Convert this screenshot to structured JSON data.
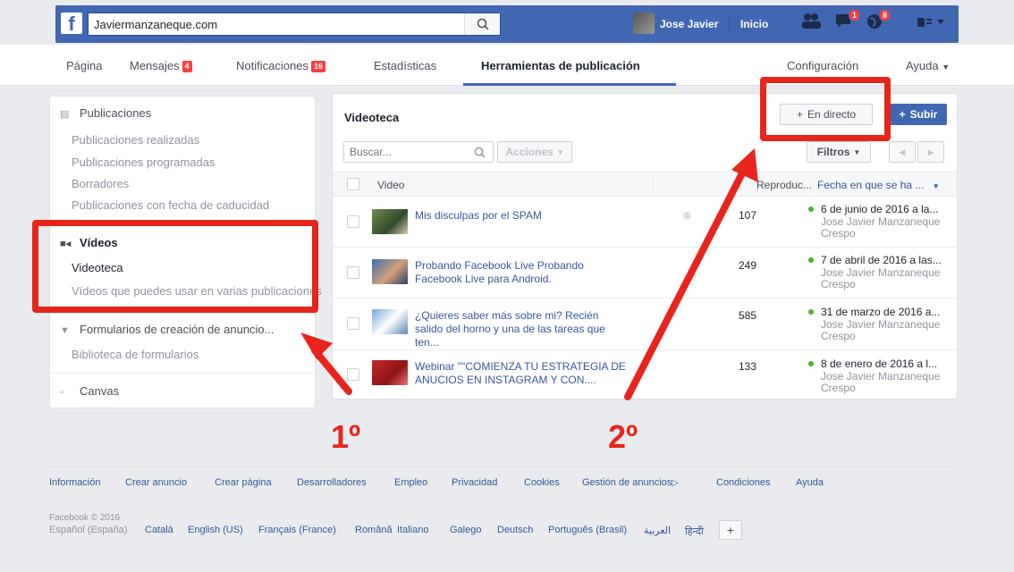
{
  "topbar": {
    "search_value": "Javiermanzaneque.com",
    "user_name": "Jose Javier",
    "home_label": "Inicio",
    "friend_requests_badge": "",
    "messages_badge": "1",
    "notifications_badge": "8",
    "icons": [
      "facebook-logo",
      "search-icon",
      "friends-icon",
      "messages-icon",
      "globe-icon",
      "account-menu-icon"
    ]
  },
  "tabs": {
    "pagina": "Página",
    "mensajes": "Mensajes",
    "mensajes_badge": "4",
    "notificaciones": "Notificaciones",
    "notificaciones_badge": "16",
    "estadisticas": "Estadísticas",
    "herramientas": "Herramientas de publicación",
    "configuracion": "Configuración",
    "ayuda": "Ayuda"
  },
  "sidebar": {
    "publicaciones_header": "Publicaciones",
    "publicaciones_realizadas": "Publicaciones realizadas",
    "publicaciones_programadas": "Publicaciones programadas",
    "borradores": "Borradores",
    "publicaciones_caducidad": "Publicaciones con fecha de caducidad",
    "videos_header": "Vídeos",
    "videoteca": "Videoteca",
    "videos_varias": "Vídeos que puedes usar en varias publicaciones",
    "formularios_header": "Formularios de creación de anuncio...",
    "biblioteca_formularios": "Biblioteca de formularios",
    "canvas": "Canvas"
  },
  "library": {
    "title": "Videoteca",
    "live_button": "En directo",
    "upload_button": "Subir",
    "search_placeholder": "Buscar...",
    "actions_label": "Acciones",
    "filters_label": "Filtros",
    "columns": {
      "video": "Video",
      "reach": "Reproduc...",
      "date": "Fecha en que se ha ..."
    },
    "rows": [
      {
        "title": "Mis disculpas por el SPAM",
        "reach": "107",
        "date": "6 de junio de 2016 a la...",
        "author": "Jose Javier Manzaneque Crespo"
      },
      {
        "title": "Probando Facebook Live Probando Facebook Live para Android.",
        "reach": "249",
        "date": "7 de abril de 2016 a las...",
        "author": "Jose Javier Manzaneque Crespo"
      },
      {
        "title": "¿Quieres saber más sobre mi? Recién salido del horno y una de las tareas que ten...",
        "reach": "585",
        "date": "31 de marzo de 2016 a...",
        "author": "Jose Javier Manzaneque Crespo"
      },
      {
        "title": "Webinar \"\"COMIENZA TU ESTRATEGIA DE ANUCIOS EN INSTAGRAM Y CON....",
        "reach": "133",
        "date": "8 de enero de 2016 a l...",
        "author": "Jose Javier Manzaneque Crespo"
      }
    ]
  },
  "annotations": {
    "step1": "1º",
    "step2": "2º",
    "color": "#e8251b"
  },
  "footer": {
    "links": [
      "Información",
      "Crear anuncio",
      "Crear página",
      "Desarrolladores",
      "Empleo",
      "Privacidad",
      "Cookies",
      "Gestión de anuncios",
      "Condiciones",
      "Ayuda"
    ],
    "copyright": "Facebook © 2016",
    "languages": [
      "Español (España)",
      "Català",
      "English (US)",
      "Français (France)",
      "Română",
      "Italiano",
      "Galego",
      "Deutsch",
      "Português (Brasil)",
      "العربية",
      "हिन्दी"
    ],
    "more_languages": "+"
  },
  "colors": {
    "brand": "#4267b2",
    "badge": "#fa3e3e",
    "link": "#365899"
  }
}
